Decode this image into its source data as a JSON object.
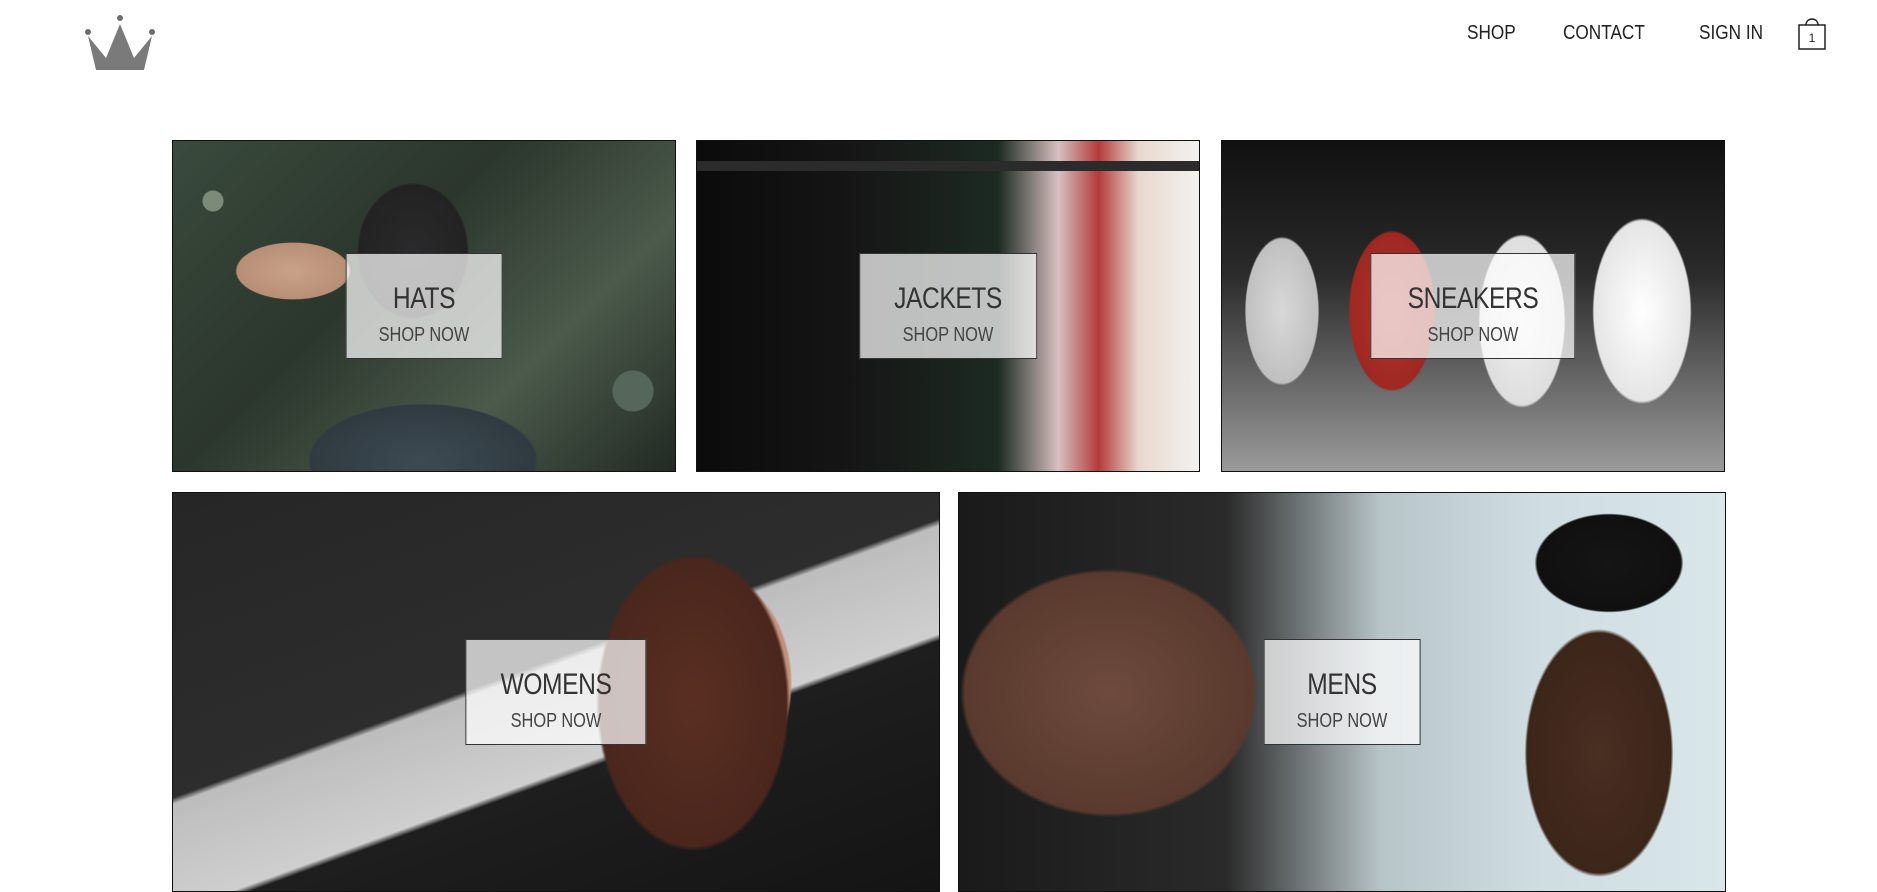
{
  "header": {
    "logo_icon": "crown-icon",
    "nav": [
      {
        "label": "SHOP"
      },
      {
        "label": "CONTACT"
      },
      {
        "label": "SIGN IN"
      }
    ],
    "cart": {
      "icon": "shopping-bag-icon",
      "count": "1"
    }
  },
  "categories": [
    {
      "title": "HATS",
      "cta": "SHOP NOW"
    },
    {
      "title": "JACKETS",
      "cta": "SHOP NOW"
    },
    {
      "title": "SNEAKERS",
      "cta": "SHOP NOW"
    },
    {
      "title": "WOMENS",
      "cta": "SHOP NOW"
    },
    {
      "title": "MENS",
      "cta": "SHOP NOW"
    }
  ],
  "colors": {
    "text": "#222222",
    "border": "#111111",
    "label_bg": "rgba(255,255,255,0.72)",
    "logo_gray": "#7a7a7a"
  }
}
